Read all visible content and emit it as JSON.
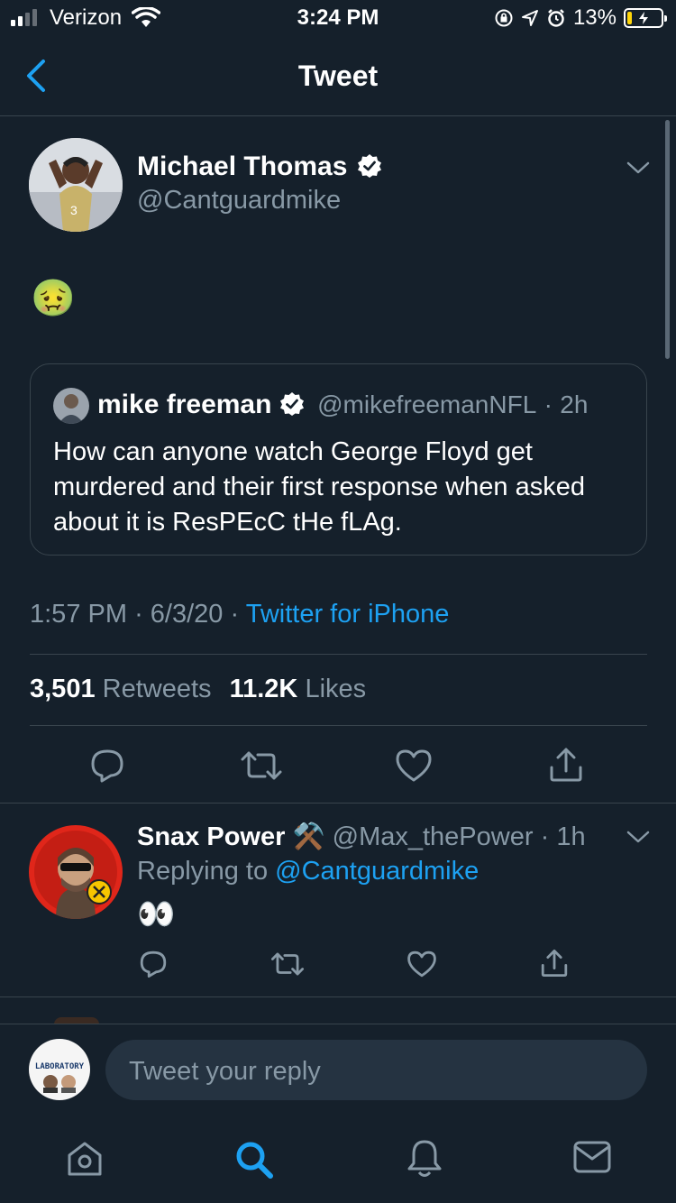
{
  "status_bar": {
    "carrier": "Verizon",
    "time": "3:24 PM",
    "battery": "13%",
    "battery_level": 0.13
  },
  "nav": {
    "title": "Tweet"
  },
  "tweet": {
    "author_name": "Michael Thomas",
    "author_handle": "@Cantguardmike",
    "body_emoji": "🤢",
    "quoted": {
      "author_name": "mike freeman",
      "author_handle": "@mikefreemanNFL",
      "separator": "·",
      "age": "2h",
      "text": "How can anyone watch George Floyd get murdered and their first response when asked about it is ResPEcC tHe fLAg."
    },
    "time": "1:57 PM",
    "sep1": "·",
    "date": "6/3/20",
    "sep2": "·",
    "source": "Twitter for iPhone",
    "retweet_count": "3,501",
    "retweet_label": "Retweets",
    "like_count": "11.2K",
    "like_label": "Likes"
  },
  "reply": {
    "author_name": "Snax Power",
    "author_emoji": "⚒️",
    "author_handle": "@Max_thePower",
    "separator": "·",
    "age": "1h",
    "replying_prefix": "Replying to",
    "replying_to": "@Cantguardmike",
    "body": "👀"
  },
  "composer": {
    "avatar_text": "LABORATORY",
    "placeholder": "Tweet your reply"
  },
  "colors": {
    "background": "#15202b",
    "accent": "#1da1f2",
    "muted": "#8899a6",
    "divider": "#38444d"
  }
}
